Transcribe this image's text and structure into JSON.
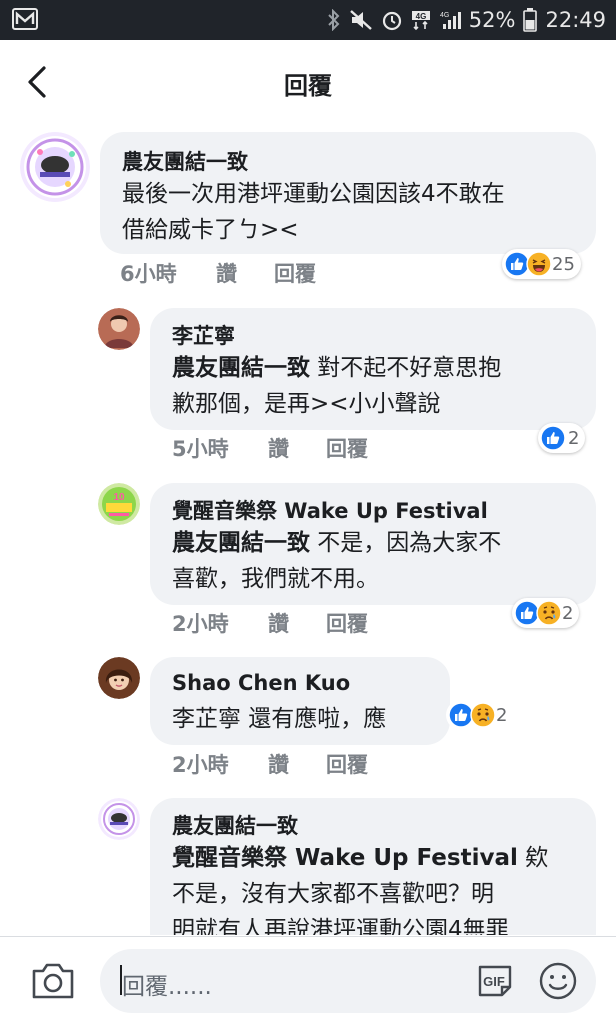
{
  "status_bar": {
    "battery": "52%",
    "time": "22:49",
    "network": "4G"
  },
  "header": {
    "title": "回覆",
    "back_icon": "arrow-left-icon"
  },
  "comments": [
    {
      "author": "農友團結一致",
      "text_lines": [
        "最後一次用港坪運動公園因該4不敢在",
        "借給威卡了ㄅ><"
      ],
      "time": "6小時",
      "like": "讚",
      "reply": "回覆",
      "reactions": [
        "like",
        "haha"
      ],
      "reaction_count": "25"
    },
    {
      "author": "李芷寧",
      "mention": "農友團結一致",
      "text_lines": [
        " 對不起不好意思抱",
        "歉那個，是再><小小聲說"
      ],
      "time": "5小時",
      "like": "讚",
      "reply": "回覆",
      "reactions": [
        "like"
      ],
      "reaction_count": "2"
    },
    {
      "author": "覺醒音樂祭 Wake Up Festival",
      "mention": "農友團結一致",
      "text_lines": [
        " 不是，因為大家不",
        "喜歡，我們就不用。"
      ],
      "time": "2小時",
      "like": "讚",
      "reply": "回覆",
      "reactions": [
        "like",
        "sad"
      ],
      "reaction_count": "2"
    },
    {
      "author": "Shao Chen Kuo",
      "mention": "李芷寧",
      "text_lines": [
        " 還有應啦，應"
      ],
      "time": "2小時",
      "like": "讚",
      "reply": "回覆",
      "reactions": [
        "like",
        "sad"
      ],
      "reaction_count": "2"
    },
    {
      "author": "農友團結一致",
      "mention": "覺醒音樂祭 Wake Up Festival",
      "text_lines": [
        " 欸",
        "不是，沒有大家都不喜歡吧？明",
        "明就有人再說港坪運動公園4無罪"
      ]
    }
  ],
  "composer": {
    "placeholder": "回覆......",
    "camera_icon": "camera-icon",
    "gif_label": "GIF",
    "emoji_icon": "smiley-icon"
  },
  "colors": {
    "bubble": "#f0f2f5",
    "like_blue": "#1877f2",
    "emoji_yellow": "#f7b125",
    "status_bar": "#20242a"
  }
}
